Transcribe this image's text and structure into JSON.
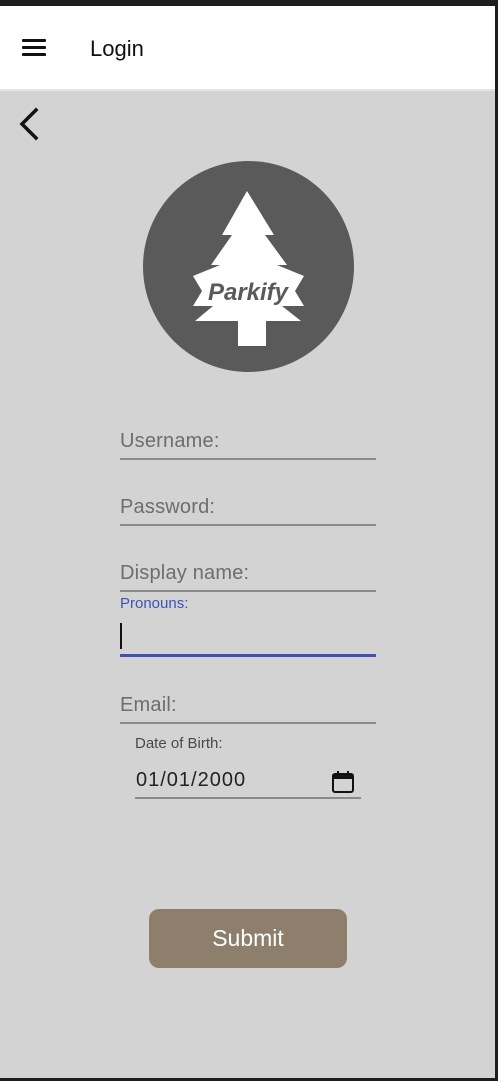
{
  "app_bar": {
    "title": "Login",
    "menu_icon": "hamburger-menu-icon"
  },
  "nav": {
    "back_icon": "chevron-left-icon"
  },
  "logo": {
    "text": "Parkify",
    "icon": "pine-tree-icon"
  },
  "form": {
    "username": {
      "placeholder": "Username:",
      "value": ""
    },
    "password": {
      "placeholder": "Password:",
      "value": ""
    },
    "display_name": {
      "placeholder": "Display name:",
      "value": ""
    },
    "pronouns": {
      "label": "Pronouns:",
      "value": ""
    },
    "email": {
      "placeholder": "Email:",
      "value": ""
    },
    "date_of_birth": {
      "label": "Date of Birth:",
      "value": "01/01/2000",
      "icon": "calendar-icon"
    }
  },
  "submit": {
    "label": "Submit"
  },
  "colors": {
    "background": "#d3d3d3",
    "app_bar": "#ffffff",
    "logo_circle": "#5a5a5a",
    "focus_accent": "#3f51b5",
    "submit_button": "#8d7f6c"
  }
}
